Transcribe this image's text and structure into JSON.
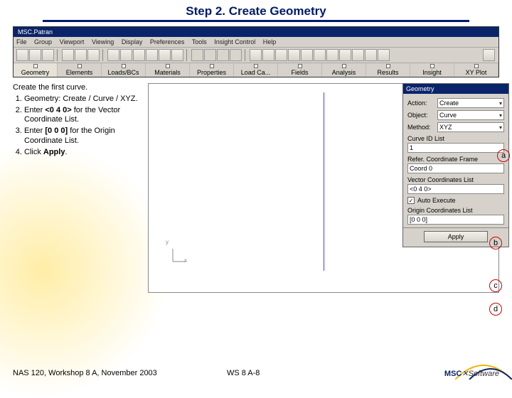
{
  "title": "Step 2. Create Geometry",
  "app_title": "MSC.Patran",
  "menu": [
    "File",
    "Group",
    "Viewport",
    "Viewing",
    "Display",
    "Preferences",
    "Tools",
    "Insight Control",
    "Help"
  ],
  "tabs": [
    "Geometry",
    "Elements",
    "Loads/BCs",
    "Materials",
    "Properties",
    "Load Ca...",
    "Fields",
    "Analysis",
    "Results",
    "Insight",
    "XY Plot"
  ],
  "instructions": {
    "lead": "Create the first curve.",
    "items": [
      "Geometry: Create / Curve / XYZ.",
      "Enter <0 4 0> for the Vector Coordinate List.",
      "Enter [0 0 0] for the Origin Coordinate List.",
      "Click Apply."
    ],
    "bold": {
      "1": "<0 4 0>",
      "2": "[0 0 0]",
      "3": "Apply"
    }
  },
  "axis": {
    "x": "x",
    "y": "y"
  },
  "geo": {
    "title": "Geometry",
    "action_label": "Action:",
    "action_value": "Create",
    "object_label": "Object:",
    "object_value": "Curve",
    "method_label": "Method:",
    "method_value": "XYZ",
    "curve_id_label": "Curve ID List",
    "curve_id_value": "1",
    "refcoord_label": "Refer. Coordinate Frame",
    "refcoord_value": "Coord 0",
    "vector_label": "Vector Coordinates List",
    "vector_value": "<0 4 0>",
    "auto_execute": "Auto Execute",
    "origin_label": "Origin Coordinates List",
    "origin_value": "[0 0 0]",
    "apply": "Apply"
  },
  "callouts": {
    "a": "a",
    "b": "b",
    "c": "c",
    "d": "d"
  },
  "footer": {
    "left": "NAS 120, Workshop 8 A, November 2003",
    "center": "WS 8 A-8",
    "logo_pre": "MSC",
    "logo_post": "Software"
  }
}
